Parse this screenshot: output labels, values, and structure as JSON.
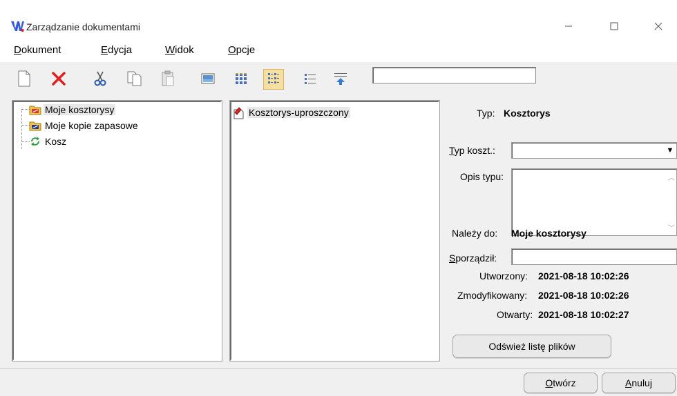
{
  "window": {
    "title": "Zarządzanie dokumentami",
    "minimize_glyph": "—",
    "maximize_glyph": "☐",
    "close_glyph": "✕"
  },
  "menu": [
    {
      "mnemonic": "D",
      "rest": "okument"
    },
    {
      "mnemonic": "E",
      "rest": "dycja"
    },
    {
      "mnemonic": "W",
      "rest": "idok"
    },
    {
      "mnemonic": "O",
      "rest": "pcje"
    }
  ],
  "toolbar": {
    "icons": [
      "new-document-icon",
      "delete-icon",
      "cut-icon",
      "copy-icon",
      "paste-icon",
      "preview-icon",
      "large-icons-view-icon",
      "small-icons-view-icon",
      "list-view-icon",
      "details-view-icon"
    ],
    "search_value": ""
  },
  "tree": {
    "items": [
      {
        "label": "Moje kosztorysy",
        "icon": "folder-icon",
        "selected": true
      },
      {
        "label": "Moje kopie zapasowe",
        "icon": "folder-icon",
        "selected": false
      },
      {
        "label": "Kosz",
        "icon": "recycle-bin-icon",
        "selected": false
      }
    ]
  },
  "files": {
    "items": [
      {
        "label": "Kosztorys-uproszczony",
        "icon": "estimate-document-icon"
      }
    ]
  },
  "properties": {
    "typ_label": "Typ:",
    "typ_value": "Kosztorys",
    "typ_koszt_mnemonic": "T",
    "typ_koszt_rest": "yp koszt.:",
    "typ_koszt_value": "",
    "opis_typu_label": "Opis typu:",
    "opis_typu_value": "",
    "nalezy_do_label": "Należy do:",
    "nalezy_do_value": "Moje kosztorysy",
    "sporzadzil_mnemonic": "S",
    "sporzadzil_rest": "porządził:",
    "sporzadzil_value": "",
    "utworzony_label": "Utworzony:",
    "utworzony_value": "2021-08-18 10:02:26",
    "zmodyfikowany_label": "Zmodyfikowany:",
    "zmodyfikowany_value": "2021-08-18 10:02:26",
    "otwarty_label": "Otwarty:",
    "otwarty_value": "2021-08-18 10:02:27",
    "refresh_label": "Odśwież listę plików"
  },
  "footer": {
    "open_mnemonic": "O",
    "open_rest": "twórz",
    "cancel_mnemonic": "A",
    "cancel_rest": "nuluj"
  },
  "colors": {
    "accent_active": "#f6dfa2",
    "delete_red": "#e02020",
    "app_icon_blue": "#3a5bd6",
    "app_icon_red": "#d62a2a"
  }
}
